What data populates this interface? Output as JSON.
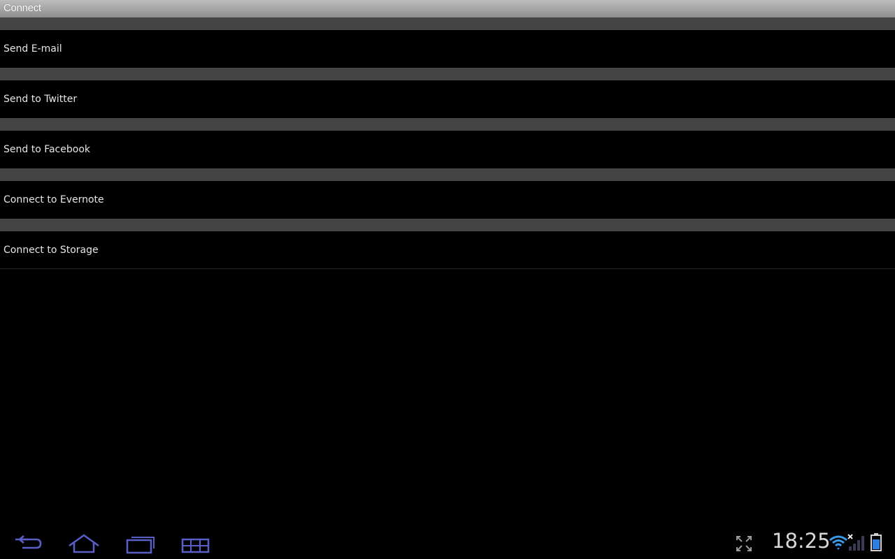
{
  "window": {
    "title": "Connect"
  },
  "menu": {
    "items": [
      {
        "label": "Send E-mail"
      },
      {
        "label": "Send to Twitter"
      },
      {
        "label": "Send to Facebook"
      },
      {
        "label": "Connect to Evernote"
      },
      {
        "label": "Connect to Storage"
      }
    ]
  },
  "system_bar": {
    "clock": "18:25",
    "icons": [
      "back-icon",
      "home-icon",
      "recent-apps-icon",
      "menu-grid-icon",
      "fullscreen-icon",
      "wifi-icon",
      "cell-signal-icon",
      "battery-icon"
    ]
  },
  "colors": {
    "background": "#000000",
    "separator": "#444444",
    "nav_icon": "#5a5fc8",
    "wifi": "#3b9bea",
    "battery": "#2f7fe0"
  }
}
